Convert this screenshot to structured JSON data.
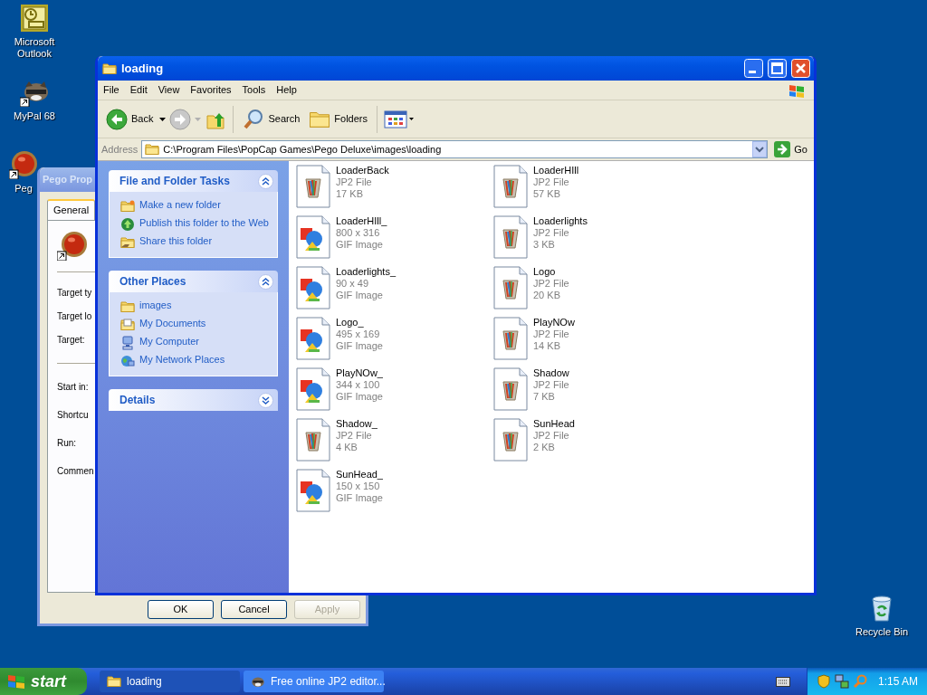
{
  "desktop_icons": [
    {
      "label": "Microsoft Outlook",
      "kind": "outlook"
    },
    {
      "label": "MyPal 68",
      "kind": "raccoon"
    },
    {
      "label": "Peg",
      "kind": "ball"
    }
  ],
  "recycle_bin": {
    "label": "Recycle Bin"
  },
  "properties_dialog": {
    "title": "Pego Prop",
    "tabs": [
      {
        "label": "General",
        "selected": true
      }
    ],
    "field_groups": [
      [
        "Target ty",
        "Target lo",
        "Target:"
      ],
      [
        "Start in:",
        "Shortcu",
        "Run:",
        "Commen"
      ]
    ],
    "buttons": [
      {
        "label": "OK",
        "disabled": false
      },
      {
        "label": "Cancel",
        "disabled": false
      },
      {
        "label": "Apply",
        "disabled": true
      }
    ]
  },
  "explorer": {
    "title": "loading",
    "menu": [
      "File",
      "Edit",
      "View",
      "Favorites",
      "Tools",
      "Help"
    ],
    "toolbar": {
      "back": "Back",
      "search": "Search",
      "folders": "Folders"
    },
    "address": {
      "label": "Address",
      "path": "C:\\Program Files\\PopCap Games\\Pego Deluxe\\images\\loading",
      "go": "Go"
    },
    "panels": [
      {
        "title": "File and Folder Tasks",
        "expanded": true,
        "items": [
          {
            "label": "Make a new folder",
            "kind": "new-folder"
          },
          {
            "label": "Publish this folder to the Web",
            "kind": "globe"
          },
          {
            "label": "Share this folder",
            "kind": "shared-folder"
          }
        ]
      },
      {
        "title": "Other Places",
        "expanded": true,
        "items": [
          {
            "label": "images",
            "kind": "folder"
          },
          {
            "label": "My Documents",
            "kind": "documents"
          },
          {
            "label": "My Computer",
            "kind": "computer"
          },
          {
            "label": "My Network Places",
            "kind": "network"
          }
        ]
      },
      {
        "title": "Details",
        "expanded": false
      }
    ],
    "files": [
      {
        "name": "LoaderBack",
        "line2": "JP2 File",
        "line3": "17 KB",
        "kind": "jp2"
      },
      {
        "name": "LoaderHIll",
        "line2": "JP2 File",
        "line3": "57 KB",
        "kind": "jp2"
      },
      {
        "name": "LoaderHIll_",
        "line2": "800 x 316",
        "line3": "GIF Image",
        "kind": "gif"
      },
      {
        "name": "Loaderlights",
        "line2": "JP2 File",
        "line3": "3 KB",
        "kind": "jp2"
      },
      {
        "name": "Loaderlights_",
        "line2": "90 x 49",
        "line3": "GIF Image",
        "kind": "gif"
      },
      {
        "name": "Logo",
        "line2": "JP2 File",
        "line3": "20 KB",
        "kind": "jp2"
      },
      {
        "name": "Logo_",
        "line2": "495 x 169",
        "line3": "GIF Image",
        "kind": "gif"
      },
      {
        "name": "PlayNOw",
        "line2": "JP2 File",
        "line3": "14 KB",
        "kind": "jp2"
      },
      {
        "name": "PlayNOw_",
        "line2": "344 x 100",
        "line3": "GIF Image",
        "kind": "gif"
      },
      {
        "name": "Shadow",
        "line2": "JP2 File",
        "line3": "7 KB",
        "kind": "jp2"
      },
      {
        "name": "Shadow_",
        "line2": "JP2 File",
        "line3": "4 KB",
        "kind": "jp2"
      },
      {
        "name": "SunHead",
        "line2": "JP2 File",
        "line3": "2 KB",
        "kind": "jp2"
      },
      {
        "name": "SunHead_",
        "line2": "150 x 150",
        "line3": "GIF Image",
        "kind": "gif"
      }
    ]
  },
  "taskbar": {
    "start": "start",
    "tasks": [
      {
        "label": "loading",
        "selected": true,
        "kind": "folder"
      },
      {
        "label": "Free online JP2 editor...",
        "selected": false,
        "kind": "raccoon"
      }
    ],
    "clock": "1:15 AM"
  }
}
